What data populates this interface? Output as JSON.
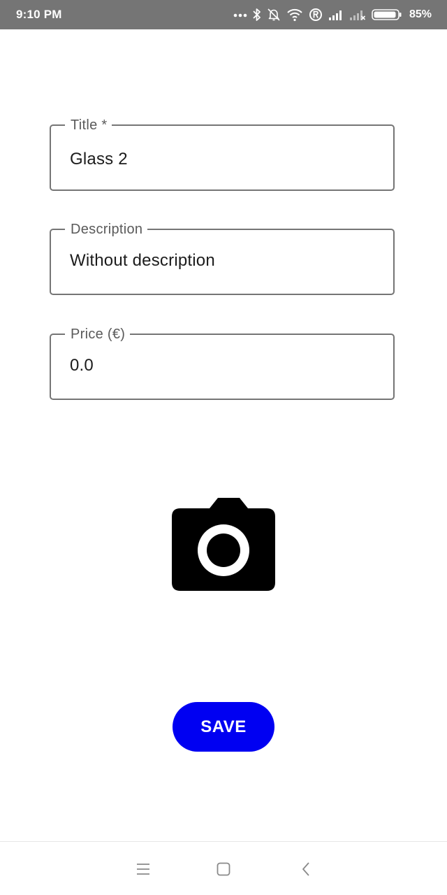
{
  "status_bar": {
    "time": "9:10 PM",
    "battery_percent": "85%",
    "icons": [
      "more-dots-icon",
      "bluetooth-icon",
      "alarm-off-icon",
      "wifi-icon",
      "registered-icon",
      "signal-icon",
      "signal-off-icon",
      "battery-icon"
    ]
  },
  "form": {
    "title": {
      "label": "Title *",
      "value": "Glass 2"
    },
    "description": {
      "label": "Description",
      "value": "Without description"
    },
    "price": {
      "label": "Price (€)",
      "value": "0.0"
    }
  },
  "camera": {
    "icon": "camera-icon"
  },
  "actions": {
    "save_label": "SAVE"
  },
  "colors": {
    "status_bar": "#757575",
    "save_button": "#0000f2",
    "field_border": "#757575"
  },
  "nav_bar": {
    "icons": [
      "menu-icon",
      "home-icon",
      "back-icon"
    ]
  }
}
